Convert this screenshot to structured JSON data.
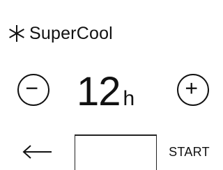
{
  "header": {
    "icon": "snowflake-asterisk-icon",
    "title": "SuperCool"
  },
  "stepper": {
    "decrement_icon": "minus-circle-icon",
    "value": "12",
    "unit": "h",
    "increment_icon": "plus-circle-icon"
  },
  "footer": {
    "back_icon": "arrow-left-icon",
    "start_label": "START"
  },
  "colors": {
    "foreground": "#111111",
    "background": "#ffffff"
  }
}
